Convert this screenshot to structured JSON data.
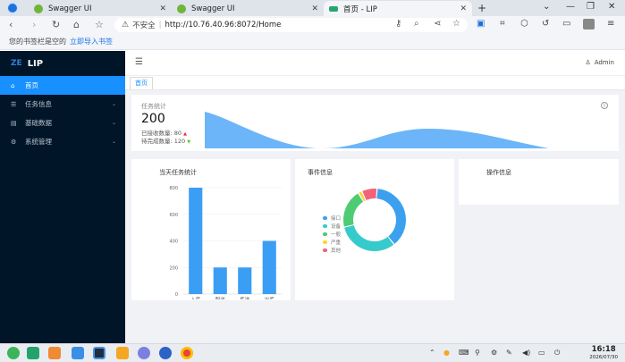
{
  "browser": {
    "tabs": [
      {
        "title": "Swagger UI",
        "active": false
      },
      {
        "title": "Swagger UI",
        "active": false
      },
      {
        "title": "首页 - LIP",
        "active": true
      }
    ],
    "new_tab": "+",
    "address": {
      "security": "不安全",
      "url": "http://10.76.40.96:8072/Home"
    },
    "bookmarks": {
      "empty_text": "您的书签栏是空的",
      "import_link": "立即导入书签"
    }
  },
  "app": {
    "logo_mark": "ZE",
    "name": "LIP",
    "user": "Admin",
    "menu": [
      {
        "label": "首页",
        "icon": "home-icon",
        "active": true
      },
      {
        "label": "任务信息",
        "icon": "list-icon",
        "active": false
      },
      {
        "label": "基础数据",
        "icon": "grid-icon",
        "active": false
      },
      {
        "label": "系统管理",
        "icon": "gear-icon",
        "active": false
      }
    ],
    "page_tag": "首页"
  },
  "stats": {
    "label": "任务统计",
    "total": "200",
    "received_label": "已接收数量:",
    "received_value": "80",
    "pending_label": "待完成数量:",
    "pending_value": "120"
  },
  "cards": {
    "bar_title": "当天任务统计",
    "event_title": "事件信息",
    "op_title": "操作信息"
  },
  "chart_data": [
    {
      "type": "bar",
      "title": "当天任务统计",
      "categories": [
        "入库",
        "配送",
        "拣选",
        "出库"
      ],
      "values": [
        800,
        200,
        200,
        400
      ],
      "ylim": [
        0,
        800
      ],
      "yticks": [
        0,
        200,
        400,
        600,
        800
      ],
      "color": "#3b9ef5",
      "grid": true
    },
    {
      "type": "pie",
      "title": "事件信息",
      "donut": true,
      "legend": "left",
      "labels": [
        "接口",
        "设备",
        "一般",
        "严重",
        "其他"
      ],
      "values": [
        38,
        32,
        20,
        2,
        8
      ],
      "colors": [
        "#3ba1ef",
        "#36cbcb",
        "#4ecb73",
        "#fbd437",
        "#f2637b"
      ]
    }
  ],
  "taskbar": {
    "time": "16:18",
    "date": "2026/07/30"
  },
  "colors": {
    "sidebar": "#011529",
    "accent": "#1890ff",
    "area": "#6cb5f8",
    "page_bg": "#f0f2f5"
  }
}
